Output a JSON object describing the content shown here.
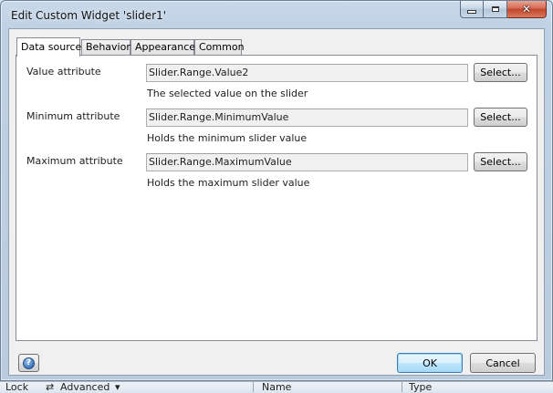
{
  "window": {
    "title": "Edit Custom Widget 'slider1'"
  },
  "tabs": [
    {
      "label": "Data source",
      "active": true
    },
    {
      "label": "Behavior",
      "active": false
    },
    {
      "label": "Appearance",
      "active": false
    },
    {
      "label": "Common",
      "active": false
    }
  ],
  "rows": [
    {
      "label": "Value attribute",
      "value": "Slider.Range.Value2",
      "help": "The selected value on the slider",
      "button": "Select..."
    },
    {
      "label": "Minimum attribute",
      "value": "Slider.Range.MinimumValue",
      "help": "Holds the minimum slider value",
      "button": "Select..."
    },
    {
      "label": "Maximum attribute",
      "value": "Slider.Range.MaximumValue",
      "help": "Holds the maximum slider value",
      "button": "Select..."
    }
  ],
  "footer": {
    "ok_label": "OK",
    "cancel_label": "Cancel",
    "help_glyph": "?"
  },
  "background": {
    "lock_label": "Lock",
    "advanced_label": "Advanced",
    "name_col": "Name",
    "type_col": "Type"
  }
}
